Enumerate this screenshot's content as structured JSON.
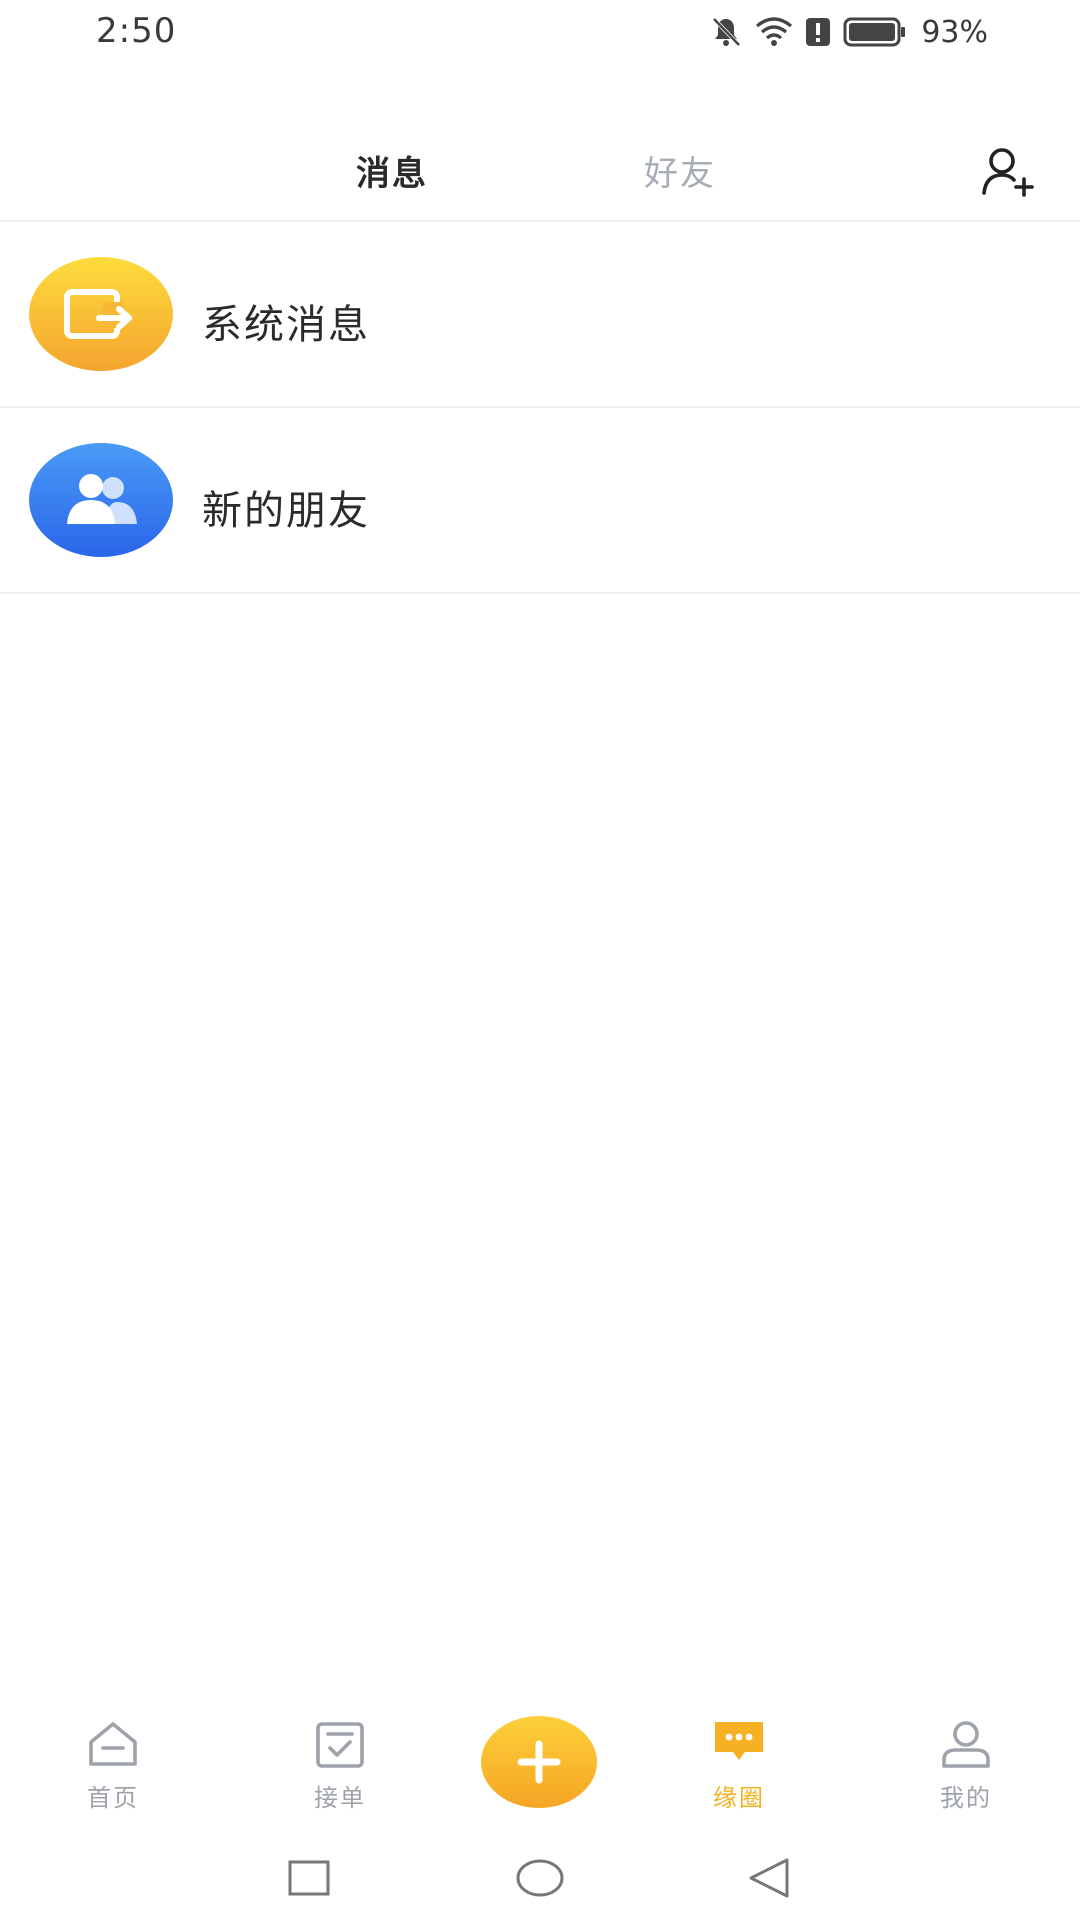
{
  "status_bar": {
    "time": "2:50",
    "battery_percent": "93%",
    "icons": [
      "bell-off-icon",
      "wifi-icon",
      "alert-icon",
      "battery-icon"
    ]
  },
  "header": {
    "tabs": [
      {
        "label": "消息",
        "active": true
      },
      {
        "label": "好友",
        "active": false
      }
    ],
    "add_friend_icon": "add-user-icon"
  },
  "list": {
    "items": [
      {
        "label": "系统消息",
        "icon": "system-message-icon",
        "color": "#f9c436"
      },
      {
        "label": "新的朋友",
        "icon": "new-friends-icon",
        "color": "#3a80f0"
      }
    ]
  },
  "bottom_nav": {
    "items": [
      {
        "label": "首页",
        "icon": "home-icon",
        "active": false
      },
      {
        "label": "接单",
        "icon": "order-check-icon",
        "active": false
      },
      {
        "label": "缘圈",
        "icon": "chat-bubble-icon",
        "active": true
      },
      {
        "label": "我的",
        "icon": "profile-icon",
        "active": false
      }
    ],
    "center_button_icon": "plus-icon",
    "accent_color": "#f3b21f",
    "inactive_color": "#9ea3ab"
  },
  "system_nav": {
    "buttons": [
      "recents-square-icon",
      "home-circle-icon",
      "back-triangle-icon"
    ]
  }
}
